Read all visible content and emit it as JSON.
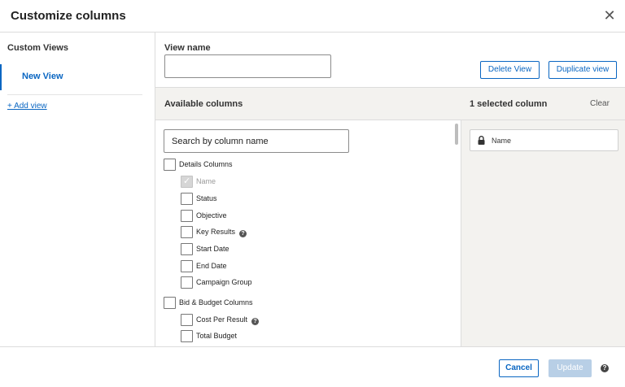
{
  "dialog": {
    "title": "Customize columns",
    "close_glyph": "✕"
  },
  "sidebar": {
    "title": "Custom Views",
    "items": [
      {
        "label": "New View",
        "active": true
      }
    ],
    "add_link": "+ Add view"
  },
  "view_name": {
    "label": "View name",
    "value": "",
    "placeholder": ""
  },
  "actions": {
    "delete": "Delete View",
    "duplicate": "Duplicate view"
  },
  "available": {
    "title": "Available columns",
    "search_placeholder": "Search by column name",
    "groups": [
      {
        "label": "Details Columns",
        "items": [
          {
            "label": "Name",
            "checked": true,
            "disabled": true
          },
          {
            "label": "Status"
          },
          {
            "label": "Objective"
          },
          {
            "label": "Key Results",
            "help": true
          },
          {
            "label": "Start Date"
          },
          {
            "label": "End Date"
          },
          {
            "label": "Campaign Group"
          }
        ]
      },
      {
        "label": "Bid & Budget Columns",
        "items": [
          {
            "label": "Cost Per Result",
            "help": true
          },
          {
            "label": "Total Budget"
          }
        ]
      }
    ]
  },
  "selected": {
    "title": "1 selected column",
    "clear": "Clear",
    "items": [
      {
        "label": "Name",
        "locked": true
      }
    ]
  },
  "footer": {
    "cancel": "Cancel",
    "update": "Update",
    "help_glyph": "?"
  },
  "icons": {
    "close": "close-icon",
    "lock": "lock-icon",
    "help": "help-icon"
  },
  "colors": {
    "accent": "#0a66c2",
    "panel_bg": "#f3f2ef",
    "update_disabled": "#b8cfe6"
  }
}
